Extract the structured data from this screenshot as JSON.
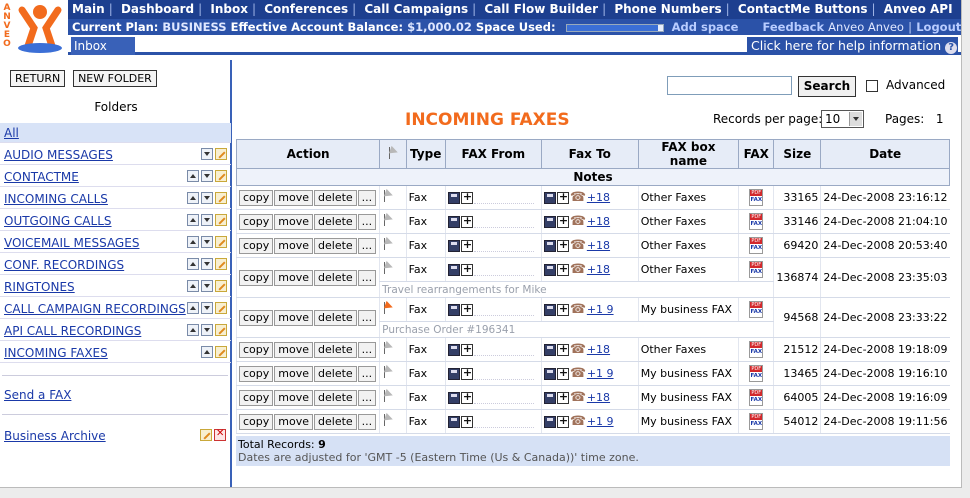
{
  "logo": {
    "text": "ANVEO"
  },
  "nav": [
    "Main",
    "Dashboard",
    "Inbox",
    "Conferences",
    "Call Campaigns",
    "Call Flow Builder",
    "Phone Numbers",
    "ContactMe Buttons",
    "Anveo API"
  ],
  "info": {
    "plan_label": "Current Plan:",
    "plan": "BUSINESS",
    "balance_label": "Effective Account Balance:",
    "balance": "$1,000.02",
    "space_label": "Space Used:",
    "space_used_fraction": 0.95,
    "add_space": "Add space",
    "feedback": "Feedback",
    "user": "Anveo Anveo",
    "logout": "Logout"
  },
  "tab": "Inbox",
  "help": "Click here for help information",
  "sidebar": {
    "return_btn": "RETURN",
    "new_folder_btn": "NEW FOLDER",
    "folders_title": "Folders",
    "all": "All",
    "folders": [
      "AUDIO MESSAGES",
      "CONTACTME",
      "INCOMING CALLS",
      "OUTGOING CALLS",
      "VOICEMAIL MESSAGES",
      "CONF. RECORDINGS",
      "RINGTONES",
      "CALL CAMPAIGN RECORDINGS",
      "API CALL RECORDINGS",
      "INCOMING FAXES"
    ],
    "send_fax": "Send a FAX",
    "business_archive": "Business Archive"
  },
  "search": {
    "button": "Search",
    "advanced": "Advanced"
  },
  "title": "INCOMING FAXES",
  "records_per_page_label": "Records per page:",
  "records_per_page": "10",
  "pages_label": "Pages:",
  "pages": "1",
  "columns": [
    "Action",
    "Type",
    "FAX From",
    "Fax To",
    "FAX box name",
    "FAX",
    "Size",
    "Date"
  ],
  "notes_header": "Notes",
  "action_buttons": [
    "copy",
    "move",
    "delete",
    "..."
  ],
  "rows": [
    {
      "type": "Fax",
      "fax_to": "+18",
      "box": "Other Faxes",
      "size": "33165",
      "date": "24-Dec-2008 23:16:12",
      "note": ""
    },
    {
      "type": "Fax",
      "fax_to": "+18",
      "box": "Other Faxes",
      "size": "33146",
      "date": "24-Dec-2008 21:04:10",
      "note": ""
    },
    {
      "type": "Fax",
      "fax_to": "+18",
      "box": "Other Faxes",
      "size": "69420",
      "date": "24-Dec-2008 20:53:40",
      "note": ""
    },
    {
      "type": "Fax",
      "fax_to": "+18",
      "box": "Other Faxes",
      "size": "136874",
      "date": "24-Dec-2008 23:35:03",
      "note": "Travel rearrangements for Mike"
    },
    {
      "type": "Fax",
      "fax_to": "+1 9",
      "box": "My business FAX",
      "size": "94568",
      "date": "24-Dec-2008 23:33:22",
      "note": "Purchase Order #196341"
    },
    {
      "type": "Fax",
      "fax_to": "+18",
      "box": "Other Faxes",
      "size": "21512",
      "date": "24-Dec-2008 19:18:09",
      "note": ""
    },
    {
      "type": "Fax",
      "fax_to": "+1 9",
      "box": "My business FAX",
      "size": "13465",
      "date": "24-Dec-2008 19:16:10",
      "note": ""
    },
    {
      "type": "Fax",
      "fax_to": "+18",
      "box": "My business FAX",
      "size": "64005",
      "date": "24-Dec-2008 19:16:09",
      "note": ""
    },
    {
      "type": "Fax",
      "fax_to": "+1 9",
      "box": "My business FAX",
      "size": "54012",
      "date": "24-Dec-2008 19:11:56",
      "note": ""
    }
  ],
  "flagged_rows": [
    4
  ],
  "footer": {
    "total_label": "Total Records:",
    "total": "9",
    "tz_note": "Dates are adjusted for 'GMT -5 (Eastern Time (Us & Canada))' time zone."
  }
}
